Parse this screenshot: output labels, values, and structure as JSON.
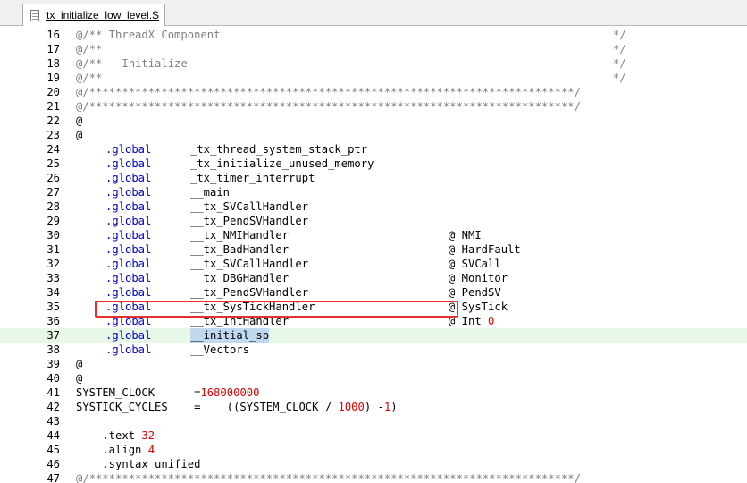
{
  "tab": {
    "label": "tx_initialize_low_level.S"
  },
  "colors": {
    "directive": "#0000c8",
    "comment": "#808080",
    "number": "#e00000",
    "highlight_box": "#e53030",
    "current_line": "#e8f8e8"
  },
  "lines": [
    {
      "n": "16",
      "text": "@/** ThreadX Component",
      "end": "*/"
    },
    {
      "n": "17",
      "text": "@/**",
      "end": "*/"
    },
    {
      "n": "18",
      "text": "@/**   Initialize",
      "end": "*/"
    },
    {
      "n": "19",
      "text": "@/**",
      "end": "*/"
    },
    {
      "n": "20",
      "text": "@/**************************************************************************/"
    },
    {
      "n": "21",
      "text": "@/**************************************************************************/"
    },
    {
      "n": "22",
      "text": "@"
    },
    {
      "n": "23",
      "text": "@"
    },
    {
      "n": "24",
      "dir": ".global",
      "arg": "_tx_thread_system_stack_ptr"
    },
    {
      "n": "25",
      "dir": ".global",
      "arg": "_tx_initialize_unused_memory"
    },
    {
      "n": "26",
      "dir": ".global",
      "arg": "_tx_timer_interrupt"
    },
    {
      "n": "27",
      "dir": ".global",
      "arg": "__main"
    },
    {
      "n": "28",
      "dir": ".global",
      "arg": "__tx_SVCallHandler"
    },
    {
      "n": "29",
      "dir": ".global",
      "arg": "__tx_PendSVHandler"
    },
    {
      "n": "30",
      "dir": ".global",
      "arg": "__tx_NMIHandler",
      "cmt": "@ NMI"
    },
    {
      "n": "31",
      "dir": ".global",
      "arg": "__tx_BadHandler",
      "cmt": "@ HardFault"
    },
    {
      "n": "32",
      "dir": ".global",
      "arg": "__tx_SVCallHandler",
      "cmt": "@ SVCall"
    },
    {
      "n": "33",
      "dir": ".global",
      "arg": "__tx_DBGHandler",
      "cmt": "@ Monitor"
    },
    {
      "n": "34",
      "dir": ".global",
      "arg": "__tx_PendSVHandler",
      "cmt": "@ PendSV"
    },
    {
      "n": "35",
      "dir": ".global",
      "arg": "__tx_SysTickHandler",
      "cmt": "@ SysTick"
    },
    {
      "n": "36",
      "dir": ".global",
      "arg": "__tx_IntHandler",
      "cmt": "@ Int",
      "cmt_num": "0"
    },
    {
      "n": "37",
      "dir": ".global",
      "arg": "__initial_sp",
      "current": true
    },
    {
      "n": "38",
      "dir": ".global",
      "arg": "__Vectors"
    },
    {
      "n": "39",
      "text": "@"
    },
    {
      "n": "40",
      "text": "@"
    },
    {
      "n": "41",
      "text": "SYSTEM_CLOCK      =",
      "num": "168000000"
    },
    {
      "n": "42",
      "text": "SYSTICK_CYCLES    =    ((SYSTEM_CLOCK / ",
      "num": "1000",
      "tail": ") -",
      "num2": "1",
      "tail2": ")"
    },
    {
      "n": "43",
      "text": ""
    },
    {
      "n": "44",
      "text": "    .text ",
      "num": "32"
    },
    {
      "n": "45",
      "text": "    .align ",
      "num": "4"
    },
    {
      "n": "46",
      "text": "    .syntax unified"
    },
    {
      "n": "47",
      "text": "@/**************************************************************************/"
    }
  ]
}
